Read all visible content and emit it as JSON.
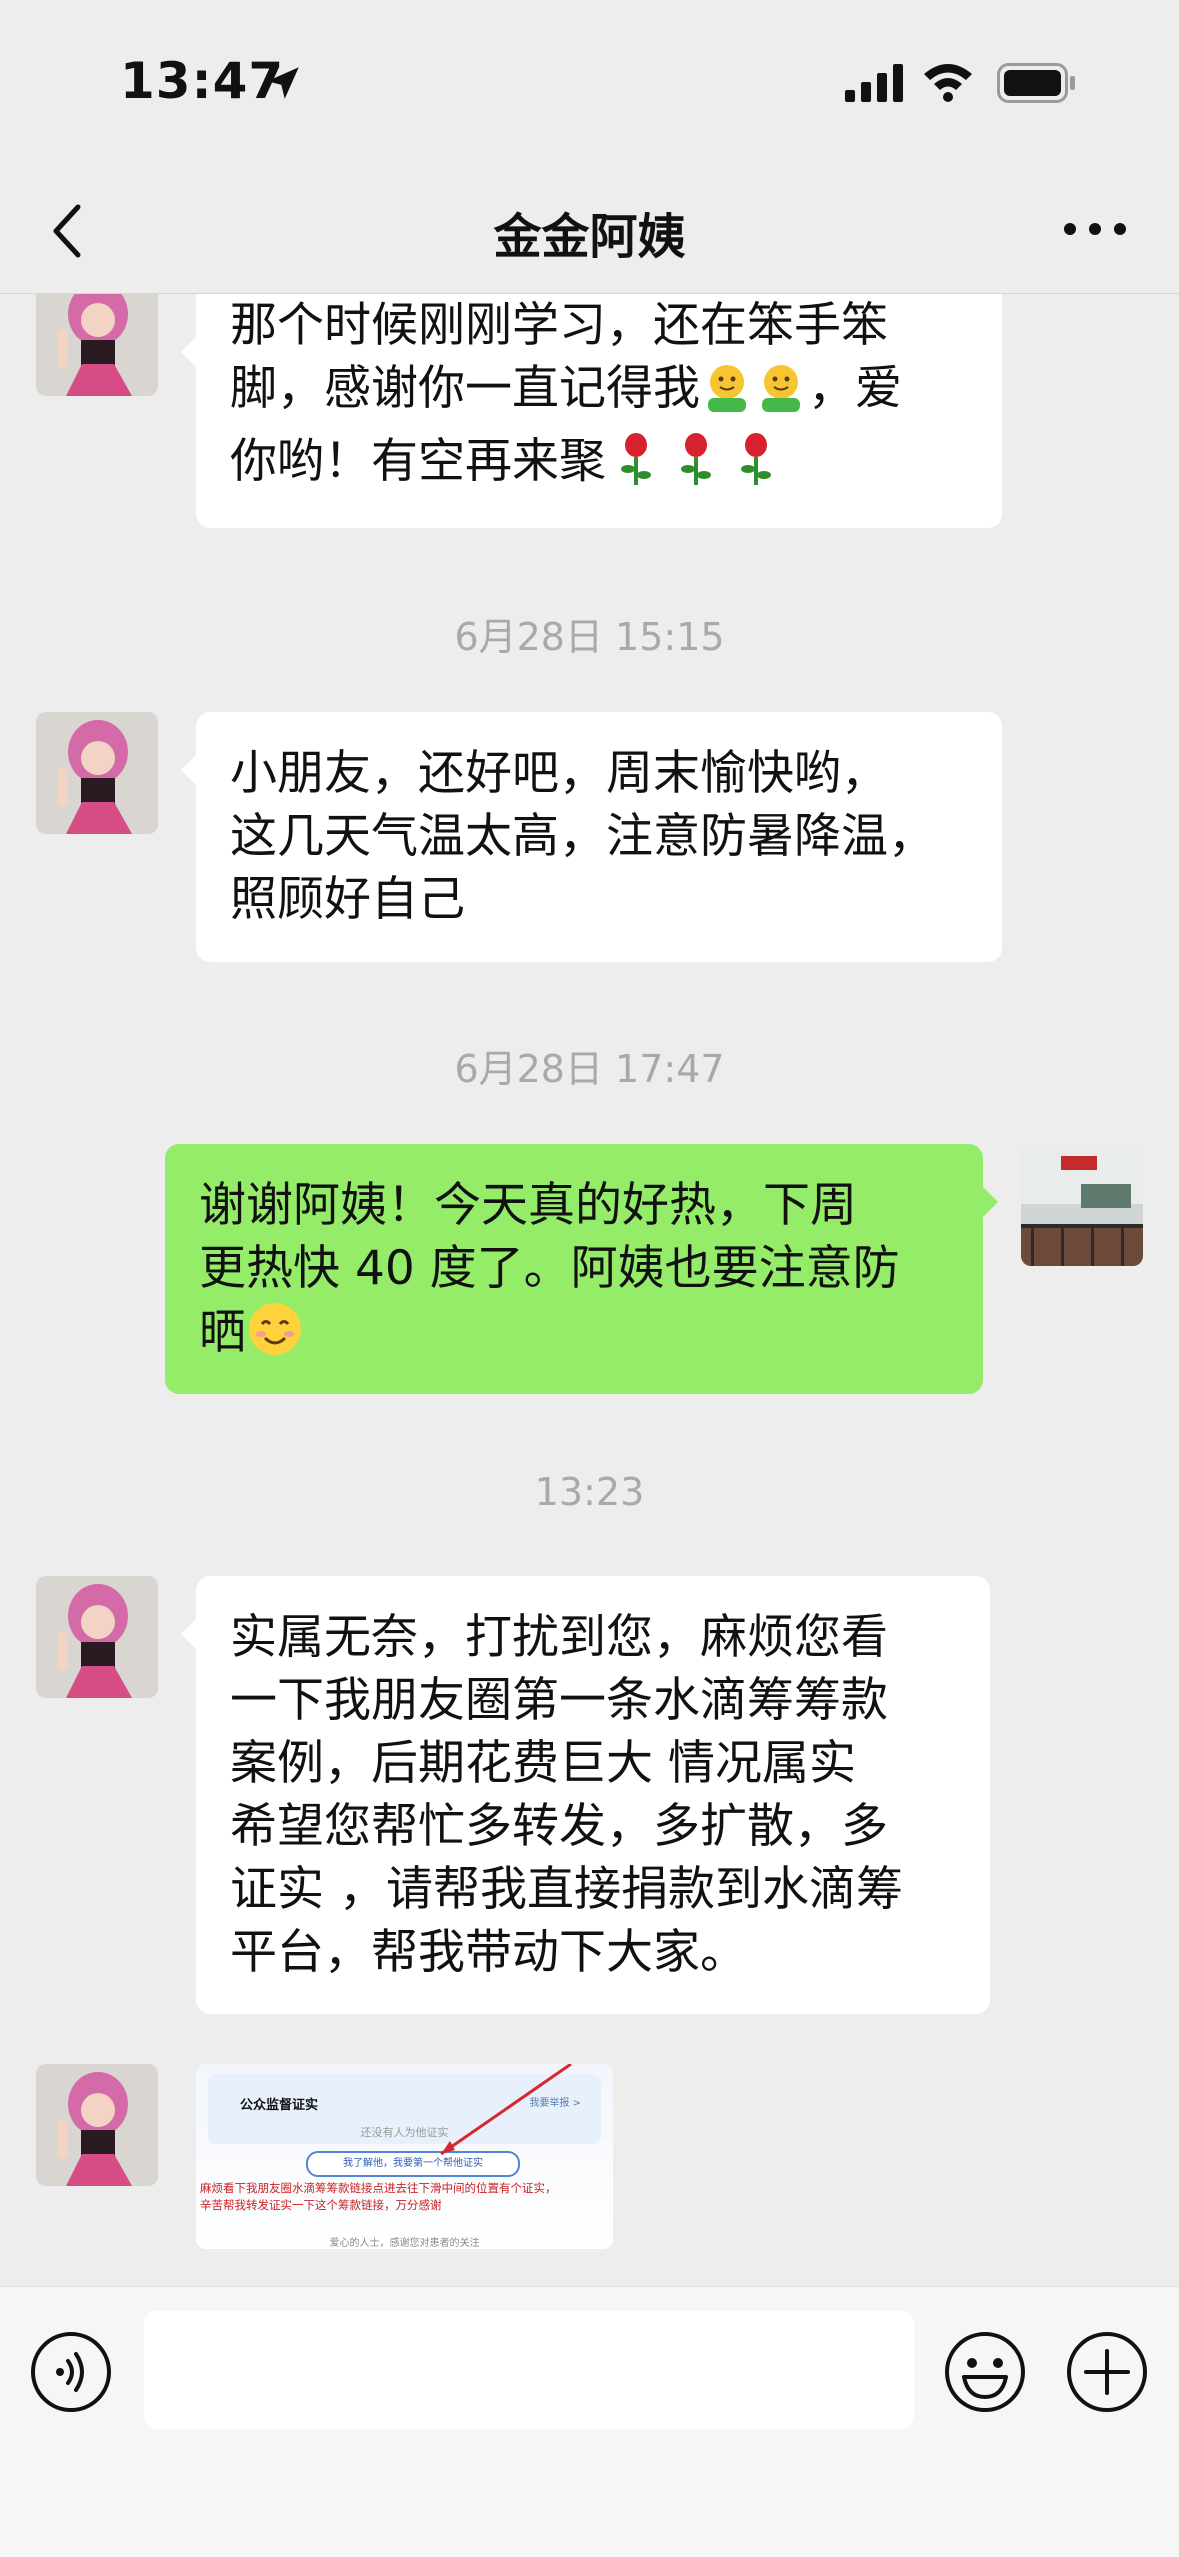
{
  "status_bar": {
    "time": "13:47"
  },
  "nav": {
    "title": "金金阿姨"
  },
  "messages": [
    {
      "side": "in",
      "text": "那个时候刚刚学习，还在笨手笨脚，感谢你一直记得我🤗🤗，爱你哟！有空再来聚🌹🌹🌹"
    },
    {
      "timestamp": "6月28日 15:15"
    },
    {
      "side": "in",
      "text": "小朋友，还好吧，周末愉快哟，这几天气温太高，注意防暑降温，照顾好自己"
    },
    {
      "timestamp": "6月28日 17:47"
    },
    {
      "side": "out",
      "text": "谢谢阿姨！今天真的好热，下周更热快 40 度了。阿姨也要注意防晒😊"
    },
    {
      "timestamp": "13:23"
    },
    {
      "side": "in",
      "text": "实属无奈，打扰到您，麻烦您看一下我朋友圈第一条水滴筹筹款案例，后期花费巨大 情况属实 希望您帮忙多转发，多扩散，多证实 ，请帮我直接捐款到水滴筹平台，帮我带动下大家。"
    },
    {
      "side": "in",
      "type": "image"
    }
  ],
  "msg1": {
    "line1": "那个时候刚刚学习，还在笨手笨",
    "line2a": "脚，感谢你一直记得我",
    "line2b": "，爱",
    "line3": "你哟！有空再来聚"
  },
  "msg2": {
    "line1": "小朋友，还好吧，周末愉快哟，",
    "line2": "这几天气温太高，注意防暑降温，",
    "line3": "照顾好自己"
  },
  "msg3": {
    "line1": "谢谢阿姨！今天真的好热，下周",
    "line2": "更热快 40 度了。阿姨也要注意防",
    "line3": "晒"
  },
  "msg4": {
    "line1": "实属无奈，打扰到您，麻烦您看",
    "line2": "一下我朋友圈第一条水滴筹筹款",
    "line3": "案例，后期花费巨大  情况属实",
    "line4": "希望您帮忙多转发，多扩散，多",
    "line5": "证实 ，请帮我直接捐款到水滴筹",
    "line6": "平台，帮我带动下大家。"
  },
  "image_message": {
    "header_title": "公众监督证实",
    "header_right": "我要举报 >",
    "subtitle": "还没有人为他证实",
    "button": "我了解他，我要第一个帮他证实",
    "overlay_line1": "麻烦看下我朋友圈水滴筹筹款链接点进去往下滑中间的位置有个证实，",
    "overlay_line2": "辛苦帮我转发证实一下这个筹款链接，万分感谢",
    "footer": "爱心的人士，感谢您对患者的关注"
  },
  "timestamps": {
    "t1": "6月28日 15:15",
    "t2": "6月28日 17:47",
    "t3": "13:23"
  },
  "colors": {
    "background": "#ededed",
    "outgoing_bubble": "#95ec69",
    "incoming_bubble": "#ffffff",
    "timestamp": "#a9a9a9"
  },
  "icons": [
    "location-arrow-icon",
    "signal-icon",
    "wifi-icon",
    "battery-icon",
    "back-chevron-icon",
    "more-icon",
    "voice-icon",
    "emoji-icon",
    "plus-icon"
  ]
}
